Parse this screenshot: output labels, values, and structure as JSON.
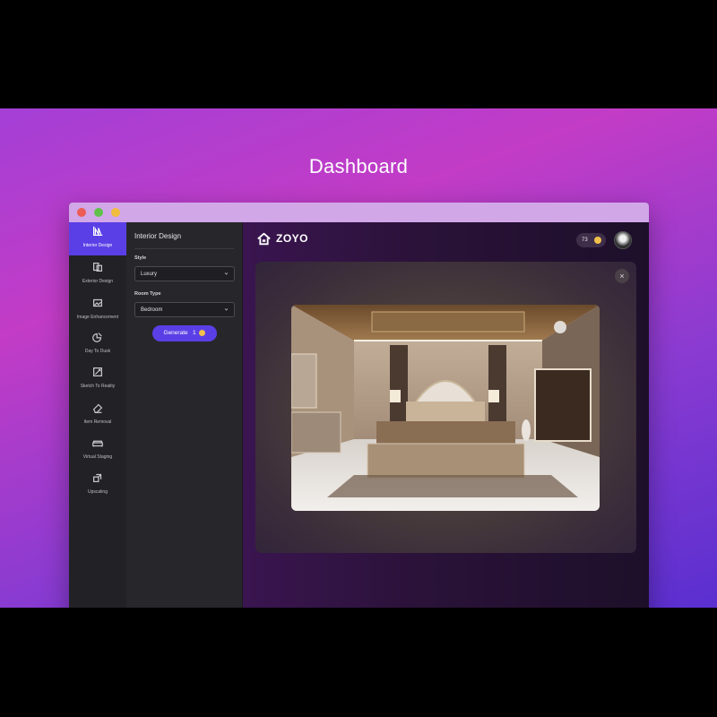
{
  "page": {
    "heading": "Dashboard"
  },
  "rail": {
    "items": [
      {
        "label": "Interior Design",
        "icon": "interior-design-icon",
        "active": true
      },
      {
        "label": "Exterior Design",
        "icon": "exterior-design-icon"
      },
      {
        "label": "Image Enhancement",
        "icon": "image-enhancement-icon"
      },
      {
        "label": "Day To Dusk",
        "icon": "day-to-dusk-icon"
      },
      {
        "label": "Sketch To Reality",
        "icon": "sketch-to-reality-icon"
      },
      {
        "label": "Item Removal",
        "icon": "eraser-icon"
      },
      {
        "label": "Virtual Staging",
        "icon": "sofa-icon"
      },
      {
        "label": "Upscaling",
        "icon": "upscale-icon"
      }
    ]
  },
  "panel": {
    "title": "Interior Design",
    "style_label": "Style",
    "style_value": "Luxury",
    "room_label": "Room Type",
    "room_value": "Bedroom",
    "generate_label": "Generate",
    "generate_cost": "1"
  },
  "header": {
    "brand": "ZOYO",
    "credits": "73"
  },
  "viewer": {
    "close_symbol": "×"
  },
  "colors": {
    "accent": "#5b3fe6",
    "coin": "#f0c14b",
    "titlebar": "#d1a7e8"
  }
}
